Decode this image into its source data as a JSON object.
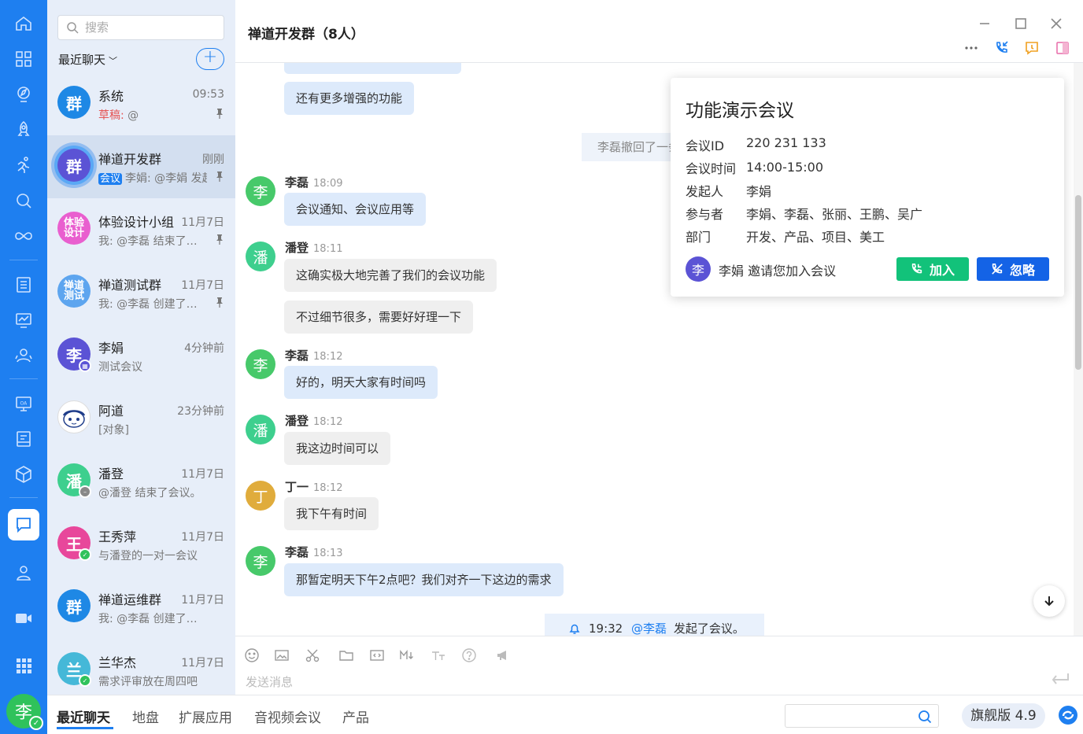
{
  "header": {
    "title": "禅道开发群（8人）"
  },
  "search": {
    "placeholder": "搜索"
  },
  "list": {
    "dropdown_label": "最近聊天",
    "add_label": "+"
  },
  "conversations": [
    {
      "name": "系统",
      "avatar": "群",
      "avatar_color": "#1e88e5",
      "time": "09:53",
      "draft": "草稿:",
      "preview": " @"
    },
    {
      "name": "禅道开发群",
      "avatar": "群",
      "avatar_color": "#5b53d5",
      "time": "刚刚",
      "tag": "会议",
      "preview": "李娟: @李娟 发起了会议。"
    },
    {
      "name": "体验设计小组",
      "avatar": "体验设计",
      "avatar_color": "#e95fcf",
      "time": "11月7日",
      "preview": "我: @李磊 结束了会议。"
    },
    {
      "name": "禅道测试群",
      "avatar": "禅道测试",
      "avatar_color": "#5da5ef",
      "time": "11月7日",
      "preview": "我: @李磊 创建了讨论。"
    },
    {
      "name": "李娟",
      "avatar": "李",
      "avatar_color": "#5b53d5",
      "time": "4分钟前",
      "preview": "测试会议"
    },
    {
      "name": "阿道",
      "avatar": "",
      "avatar_color": "#ffffff",
      "time": "23分钟前",
      "preview": "[对象]"
    },
    {
      "name": "潘登",
      "avatar": "潘",
      "avatar_color": "#3ecf8e",
      "time": "11月7日",
      "preview": "@潘登 结束了会议。"
    },
    {
      "name": "王秀萍",
      "avatar": "王",
      "avatar_color": "#e8479b",
      "time": "11月7日",
      "preview": "与潘登的一对一会议"
    },
    {
      "name": "禅道运维群",
      "avatar": "群",
      "avatar_color": "#1e88e5",
      "time": "11月7日",
      "preview": "我: @李磊 创建了讨论。"
    },
    {
      "name": "兰华杰",
      "avatar": "兰",
      "avatar_color": "#45b8d8",
      "time": "11月7日",
      "preview": "需求评审放在周四吧"
    }
  ],
  "messages": {
    "m0": "还有更多增强的功能",
    "recall": "李磊撤回了一条消息",
    "g1": {
      "avatar": "李",
      "name": "李磊",
      "time": "18:09"
    },
    "m1": "会议通知、会议应用等",
    "g2": {
      "avatar": "潘",
      "name": "潘登",
      "time": "18:11"
    },
    "m2": "这确实极大地完善了我们的会议功能",
    "m3": "不过细节很多，需要好好理一下",
    "g3": {
      "avatar": "李",
      "name": "李磊",
      "time": "18:12"
    },
    "m4": "好的，明天大家有时间吗",
    "g4": {
      "avatar": "潘",
      "name": "潘登",
      "time": "18:12"
    },
    "m5": "我这边时间可以",
    "g5": {
      "avatar": "丁",
      "name": "丁一",
      "time": "18:12"
    },
    "m6": "我下午有时间",
    "g6": {
      "avatar": "李",
      "name": "李磊",
      "time": "18:13"
    },
    "m7": "那暂定明天下午2点吧？我们对齐一下这边的需求",
    "notice": {
      "time": "19:32",
      "at": "@李磊",
      "text": "发起了会议。"
    }
  },
  "popup": {
    "title": "功能演示会议",
    "rows": [
      {
        "label": "会议ID",
        "value": "220 231 133"
      },
      {
        "label": "会议时间",
        "value": "14:00-15:00"
      },
      {
        "label": "发起人",
        "value": "李娟"
      },
      {
        "label": "参与者",
        "value": "李娟、李磊、张丽、王鹏、吴广"
      },
      {
        "label": "部门",
        "value": "开发、产品、项目、美工"
      }
    ],
    "inviter_avatar": "李",
    "invite_text": "李娟 邀请您加入会议",
    "join_label": "加入",
    "ignore_label": "忽略"
  },
  "composer": {
    "placeholder": "发送消息"
  },
  "bottom": {
    "tabs": [
      "最近聊天",
      "地盘",
      "扩展应用",
      "音视频会议",
      "产品"
    ],
    "version": "旗舰版 4.9"
  },
  "user": {
    "avatar": "李"
  },
  "colors": {
    "accent": "#1e7ff0",
    "green": "#12c27a",
    "blue_button": "#1463e6"
  }
}
